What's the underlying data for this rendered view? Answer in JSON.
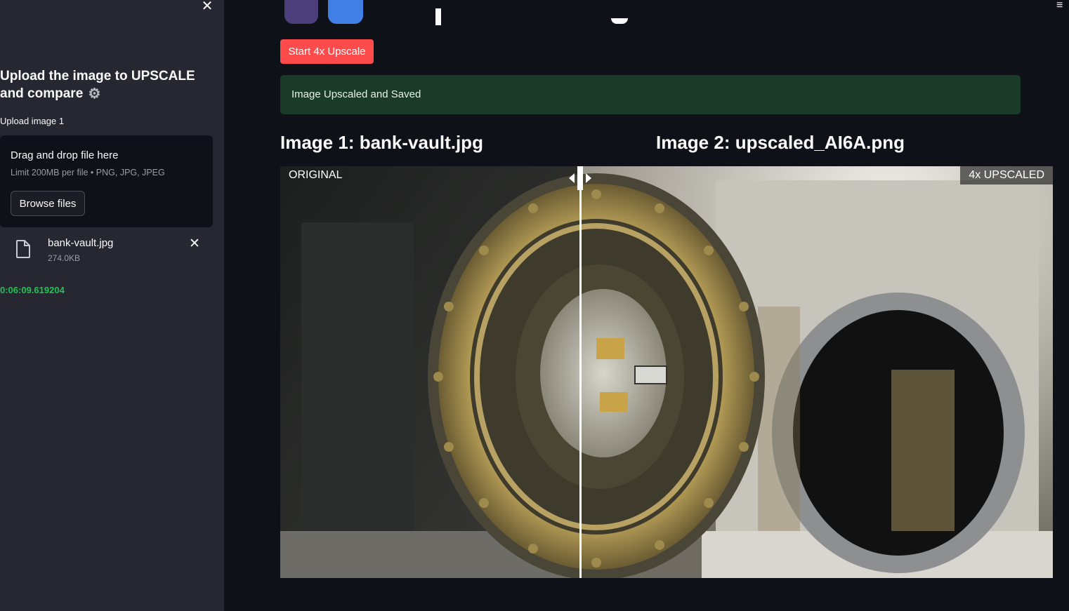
{
  "sidebar": {
    "close_symbol": "✕",
    "heading": "Upload the image to UPSCALE and compare",
    "heading_icon": "gear-icon",
    "upload_label": "Upload image 1",
    "dropzone": {
      "title": "Drag and drop file here",
      "limit": "Limit 200MB per file • PNG, JPG, JPEG",
      "browse_label": "Browse files"
    },
    "file": {
      "name": "bank-vault.jpg",
      "size": "274.0KB",
      "remove_symbol": "✕"
    },
    "elapsed": "0:06:09.619204"
  },
  "main": {
    "menu_symbol": "≡",
    "upscale_button": "Start 4x Upscale",
    "success_message": "Image Upscaled and Saved",
    "image1_title": "Image 1: bank-vault.jpg",
    "image2_title": "Image 2: upscaled_AI6A.png",
    "compare": {
      "left_label": "ORIGINAL",
      "right_label": "4x UPSCALED",
      "slider_fraction": 0.388
    }
  },
  "colors": {
    "sidebar_bg": "#262730",
    "main_bg": "#0e1117",
    "primary_button": "#ff4b4b",
    "success_bg": "#1c3a28",
    "timer_text": "#21c354"
  }
}
